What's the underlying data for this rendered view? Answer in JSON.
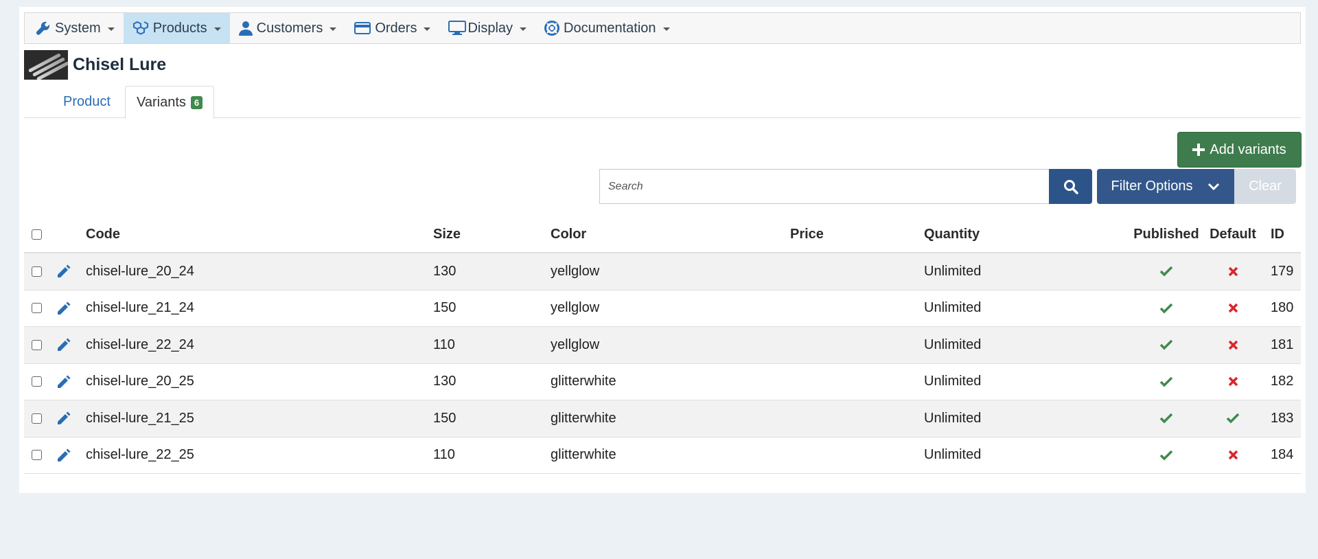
{
  "nav": {
    "items": [
      {
        "label": "System",
        "icon": "wrench-icon"
      },
      {
        "label": "Products",
        "icon": "cubes-icon"
      },
      {
        "label": "Customers",
        "icon": "user-icon"
      },
      {
        "label": "Orders",
        "icon": "credit-card-icon"
      },
      {
        "label": "Display",
        "icon": "monitor-icon"
      },
      {
        "label": "Documentation",
        "icon": "lifebuoy-icon"
      }
    ],
    "active": "Products"
  },
  "product": {
    "title": "Chisel Lure"
  },
  "tabs": {
    "product_label": "Product",
    "variants_label": "Variants",
    "variants_count": "6"
  },
  "actions": {
    "add_label": "Add variants",
    "search_placeholder": "Search",
    "filter_label": "Filter Options",
    "clear_label": "Clear"
  },
  "table": {
    "headers": {
      "code": "Code",
      "size": "Size",
      "color": "Color",
      "price": "Price",
      "quantity": "Quantity",
      "published": "Published",
      "default": "Default",
      "id": "ID"
    },
    "rows": [
      {
        "code": "chisel-lure_20_24",
        "size": "130",
        "color": "yellglow",
        "price": "",
        "quantity": "Unlimited",
        "published": true,
        "default": false,
        "id": "179"
      },
      {
        "code": "chisel-lure_21_24",
        "size": "150",
        "color": "yellglow",
        "price": "",
        "quantity": "Unlimited",
        "published": true,
        "default": false,
        "id": "180"
      },
      {
        "code": "chisel-lure_22_24",
        "size": "110",
        "color": "yellglow",
        "price": "",
        "quantity": "Unlimited",
        "published": true,
        "default": false,
        "id": "181"
      },
      {
        "code": "chisel-lure_20_25",
        "size": "130",
        "color": "glitterwhite",
        "price": "",
        "quantity": "Unlimited",
        "published": true,
        "default": false,
        "id": "182"
      },
      {
        "code": "chisel-lure_21_25",
        "size": "150",
        "color": "glitterwhite",
        "price": "",
        "quantity": "Unlimited",
        "published": true,
        "default": true,
        "id": "183"
      },
      {
        "code": "chisel-lure_22_25",
        "size": "110",
        "color": "glitterwhite",
        "price": "",
        "quantity": "Unlimited",
        "published": true,
        "default": false,
        "id": "184"
      }
    ]
  },
  "colors": {
    "accent_blue": "#2a6db5",
    "nav_active": "#c6e2f3",
    "success_green": "#3f8a4d",
    "danger_red": "#d9262c",
    "primary_dark_blue": "#2d5489"
  }
}
